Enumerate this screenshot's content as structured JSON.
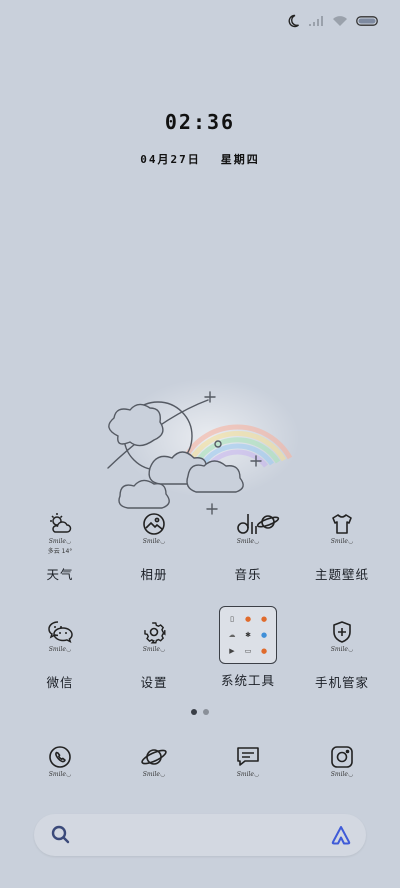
{
  "status": {
    "icons": [
      "moon-icon",
      "signal-icon",
      "wifi-icon",
      "battery-icon"
    ]
  },
  "lockscreen": {
    "time": "02:36",
    "date": "04月27日",
    "weekday": "星期四"
  },
  "apps_row1": [
    {
      "label": "天气",
      "smile": "Smile◡",
      "icon": "weather-icon",
      "weather_text": "多云 14°"
    },
    {
      "label": "相册",
      "smile": "Smile◡",
      "icon": "gallery-icon"
    },
    {
      "label": "音乐",
      "smile": "Smile◡",
      "icon": "music-icon"
    },
    {
      "label": "主题壁纸",
      "smile": "Smile◡",
      "icon": "tshirt-icon"
    }
  ],
  "apps_row2": [
    {
      "label": "微信",
      "smile": "Smile◡",
      "icon": "wechat-icon"
    },
    {
      "label": "设置",
      "smile": "Smile◡",
      "icon": "gear-icon"
    },
    {
      "label": "系统工具",
      "icon": "folder-icon"
    },
    {
      "label": "手机管家",
      "smile": "Smile◡",
      "icon": "shield-icon"
    }
  ],
  "dock": [
    {
      "smile": "Smile◡",
      "icon": "phone-icon"
    },
    {
      "smile": "Smile◡",
      "icon": "planet-icon"
    },
    {
      "smile": "Smile◡",
      "icon": "message-icon"
    },
    {
      "smile": "Smile◡",
      "icon": "camera-icon"
    }
  ],
  "pages": {
    "count": 2,
    "current": 1
  },
  "colors": {
    "background": "#c9d0db",
    "search_bar": "#d3d8e1",
    "ai_accent": "#3f5bd8"
  }
}
